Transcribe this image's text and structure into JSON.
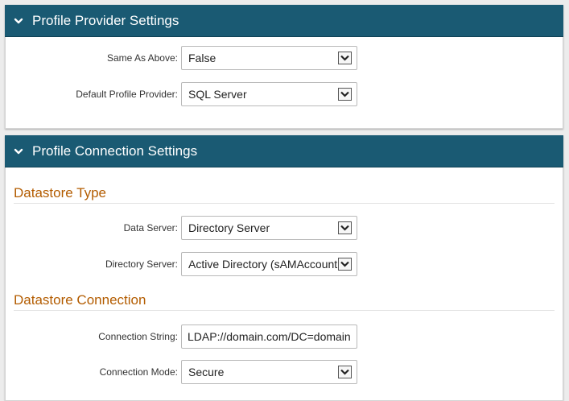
{
  "provider_panel": {
    "title": "Profile Provider Settings",
    "fields": [
      {
        "label": "Same As Above:",
        "value": "False"
      },
      {
        "label": "Default Profile Provider:",
        "value": "SQL Server"
      }
    ]
  },
  "connection_panel": {
    "title": "Profile Connection Settings",
    "datastore_type": {
      "heading": "Datastore Type",
      "fields": [
        {
          "label": "Data Server:",
          "value": "Directory Server"
        },
        {
          "label": "Directory Server:",
          "value": "Active Directory (sAMAccountName)"
        }
      ]
    },
    "datastore_connection": {
      "heading": "Datastore Connection",
      "connection_string": {
        "label": "Connection String:",
        "value": "LDAP://domain.com/DC=domain,DC=com"
      },
      "connection_mode": {
        "label": "Connection Mode:",
        "value": "Secure"
      }
    }
  },
  "colors": {
    "header_bg": "#1a5a73",
    "section_title": "#b35c00"
  },
  "icons": {
    "collapse": "chevron-down-icon",
    "dropdown": "dropdown-arrow-icon"
  }
}
